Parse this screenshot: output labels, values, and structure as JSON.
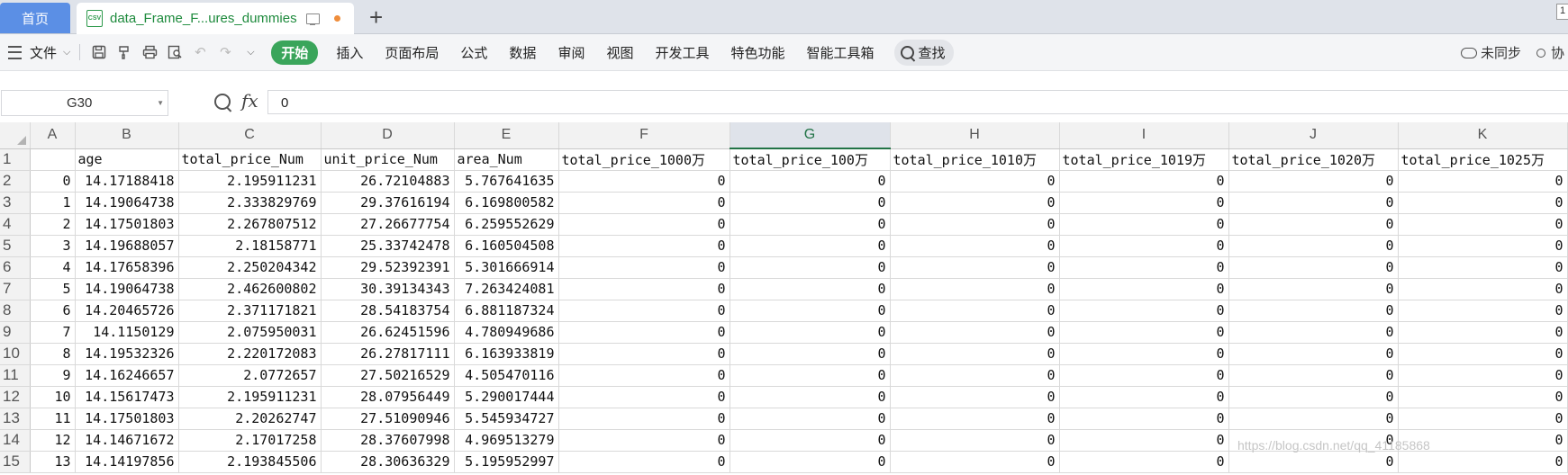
{
  "tabs": {
    "home_label": "首页",
    "doc_label": "data_Frame_F...ures_dummies",
    "doc_icon": "csv-file-icon",
    "corner_badge": "1"
  },
  "ribbon": {
    "file_label": "文件",
    "start_label": "开始",
    "items": [
      "插入",
      "页面布局",
      "公式",
      "数据",
      "审阅",
      "视图",
      "开发工具",
      "特色功能",
      "智能工具箱"
    ],
    "find_label": "查找",
    "sync_label": "未同步",
    "collab_label": "协"
  },
  "formula_bar": {
    "cell_ref": "G30",
    "fx": "fx",
    "value": "0"
  },
  "sheet": {
    "column_letters": [
      "A",
      "B",
      "C",
      "D",
      "E",
      "F",
      "G",
      "H",
      "I",
      "J",
      "K"
    ],
    "selected_column": "G",
    "header_row": [
      "",
      "age",
      "total_price_Num",
      "unit_price_Num",
      "area_Num",
      "total_price_1000万",
      "total_price_100万",
      "total_price_1010万",
      "total_price_1019万",
      "total_price_1020万",
      "total_price_1025万"
    ],
    "rows": [
      [
        "0",
        "14.17188418",
        "2.195911231",
        "26.72104883",
        "5.767641635",
        "0",
        "0",
        "0",
        "0",
        "0",
        "0"
      ],
      [
        "1",
        "14.19064738",
        "2.333829769",
        "29.37616194",
        "6.169800582",
        "0",
        "0",
        "0",
        "0",
        "0",
        "0"
      ],
      [
        "2",
        "14.17501803",
        "2.267807512",
        "27.26677754",
        "6.259552629",
        "0",
        "0",
        "0",
        "0",
        "0",
        "0"
      ],
      [
        "3",
        "14.19688057",
        "2.18158771",
        "25.33742478",
        "6.160504508",
        "0",
        "0",
        "0",
        "0",
        "0",
        "0"
      ],
      [
        "4",
        "14.17658396",
        "2.250204342",
        "29.52392391",
        "5.301666914",
        "0",
        "0",
        "0",
        "0",
        "0",
        "0"
      ],
      [
        "5",
        "14.19064738",
        "2.462600802",
        "30.39134343",
        "7.263424081",
        "0",
        "0",
        "0",
        "0",
        "0",
        "0"
      ],
      [
        "6",
        "14.20465726",
        "2.371171821",
        "28.54183754",
        "6.881187324",
        "0",
        "0",
        "0",
        "0",
        "0",
        "0"
      ],
      [
        "7",
        "14.1150129",
        "2.075950031",
        "26.62451596",
        "4.780949686",
        "0",
        "0",
        "0",
        "0",
        "0",
        "0"
      ],
      [
        "8",
        "14.19532326",
        "2.220172083",
        "26.27817111",
        "6.163933819",
        "0",
        "0",
        "0",
        "0",
        "0",
        "0"
      ],
      [
        "9",
        "14.16246657",
        "2.0772657",
        "27.50216529",
        "4.505470116",
        "0",
        "0",
        "0",
        "0",
        "0",
        "0"
      ],
      [
        "10",
        "14.15617473",
        "2.195911231",
        "28.07956449",
        "5.290017444",
        "0",
        "0",
        "0",
        "0",
        "0",
        "0"
      ],
      [
        "11",
        "14.17501803",
        "2.20262747",
        "27.51090946",
        "5.545934727",
        "0",
        "0",
        "0",
        "0",
        "0",
        "0"
      ],
      [
        "12",
        "14.14671672",
        "2.17017258",
        "28.37607998",
        "4.969513279",
        "0",
        "0",
        "0",
        "0",
        "0",
        "0"
      ],
      [
        "13",
        "14.14197856",
        "2.193845506",
        "28.30636329",
        "5.195952997",
        "0",
        "0",
        "0",
        "0",
        "0",
        "0"
      ]
    ]
  },
  "watermark": "https://blog.csdn.net/qq_41185868"
}
